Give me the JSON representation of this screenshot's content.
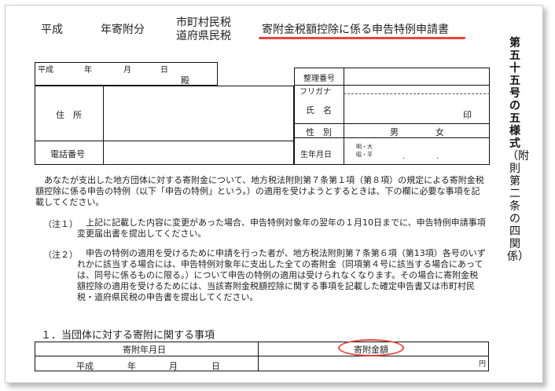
{
  "header": {
    "era": "平成",
    "year_donation": "年寄附分",
    "tax_line1": "市町村民税",
    "tax_line2": "道府県民税",
    "form_title": "寄附金税額控除に係る申告特例申請書"
  },
  "side_title": {
    "bold": "第五十五号の五様式",
    "paren": "（附則第二条の四関係）"
  },
  "colors": {
    "highlight": "#e8453c",
    "rule": "#111111"
  },
  "form": {
    "date_era": "平成",
    "date_year": "年",
    "date_month": "月",
    "date_day": "日",
    "addressee": "殿",
    "seiri_label": "整理番号",
    "furigana_label": "フリガナ",
    "address_label": "住　所",
    "name_label": "氏　名",
    "seal": "印",
    "sex_label": "性　別",
    "male": "男",
    "female": "女",
    "phone_label": "電話番号",
    "birth_label": "生年月日",
    "birth_era1": "明・大",
    "birth_era2": "昭・平",
    "birth_dots": ".　　　　."
  },
  "body": {
    "intro": "　あなたが支出した地方団体に対する寄附金について、地方税法附則第７条第１項（第８項）の規定による寄附金税額控除に係る申告の特例（以下「申告の特例」という。）の適用を受けようとするときは、下の欄に必要な事項を記載してください。",
    "note1_label": "（注１）",
    "note1": "　上記に記載した内容に変更があった場合、申告特例対象年の翌年の１月10日までに、申告特例申請事項変更届出書を提出してください。",
    "note2_label": "（注２）",
    "note2": "　申告の特例の適用を受けるために申請を行った者が、地方税法附則第７条第６項（第13項）各号のいずれかに該当する場合には、申告特例対象年に支出した全ての寄附金（同項第４号に該当する場合にあっては、同号に係るものに限る。）について申告の特例の適用は受けられなくなります。その場合に寄附金税額控除の適用を受けるためには、当該寄附金税額控除に関する事項を記載した確定申告書又は市町村民税・道府県民税の申告書を提出してください。"
  },
  "section1": {
    "heading": "１．当団体に対する寄附に関する事項",
    "col_date": "寄附年月日",
    "col_amount": "寄附金額",
    "row_era": "平成",
    "row_year": "年",
    "row_month": "月",
    "row_day": "日",
    "yen": "円"
  }
}
